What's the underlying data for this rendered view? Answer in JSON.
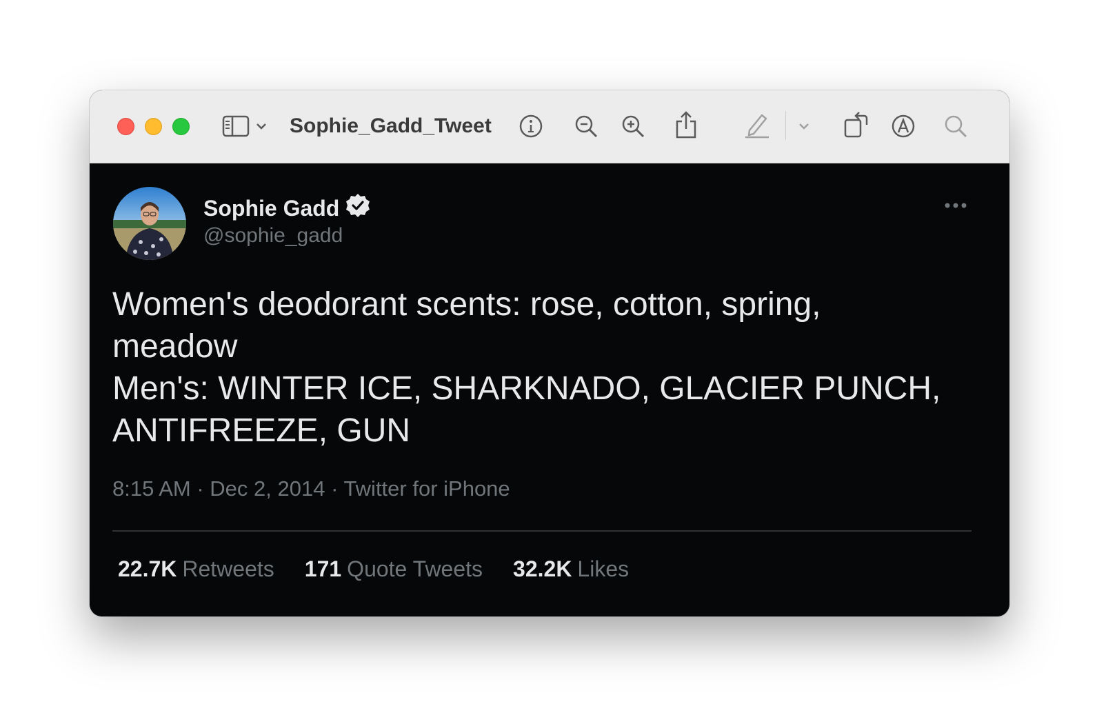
{
  "window": {
    "title": "Sophie_Gadd_Tweet"
  },
  "toolbar": {
    "icons": [
      "sidebar-icon",
      "chevron-down-icon",
      "info-icon",
      "zoom-out-icon",
      "zoom-in-icon",
      "share-icon",
      "markup-pen-icon",
      "chevron-down-icon",
      "rotate-icon",
      "markup-circle-icon",
      "search-icon"
    ]
  },
  "tweet": {
    "author_name": "Sophie Gadd",
    "handle": "@sophie_gadd",
    "verified": true,
    "text_lines": [
      "Women's deodorant scents: rose, cotton, spring,",
      "meadow",
      "Men's: WINTER ICE, SHARKNADO, GLACIER PUNCH,",
      "ANTIFREEZE, GUN"
    ],
    "meta": "8:15 AM · Dec 2, 2014 · Twitter for iPhone",
    "stats": [
      {
        "count": "22.7K",
        "label": "Retweets"
      },
      {
        "count": "171",
        "label": "Quote Tweets"
      },
      {
        "count": "32.2K",
        "label": "Likes"
      }
    ]
  },
  "colors": {
    "background": "#050709",
    "text_primary": "#e7e9ea",
    "text_secondary": "#71767b",
    "titlebar": "#ececec"
  }
}
